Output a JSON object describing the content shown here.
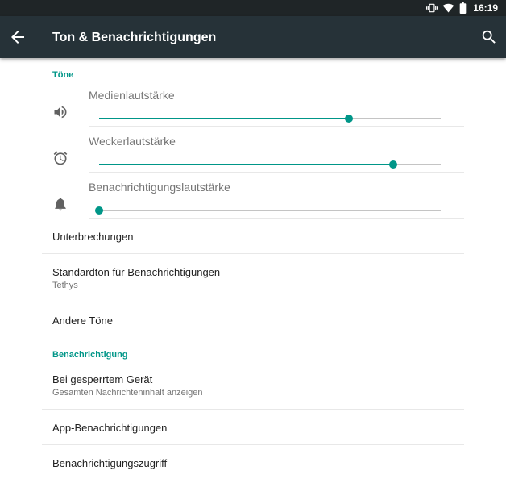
{
  "status_bar": {
    "time": "16:19",
    "icons": [
      "vibrate-icon",
      "wifi-icon",
      "battery-icon"
    ]
  },
  "toolbar": {
    "title": "Ton & Benachrichtigungen",
    "back_icon": "arrow-back-icon",
    "search_icon": "search-icon"
  },
  "colors": {
    "toolbar": "#263238",
    "status_bar": "#1f2527",
    "accent": "#009688"
  },
  "sections": {
    "tones": {
      "header": "Töne",
      "volumes": [
        {
          "label": "Medienlautstärke",
          "icon": "speaker-icon",
          "level_percent": 73
        },
        {
          "label": "Weckerlautstärke",
          "icon": "alarm-clock-icon",
          "level_percent": 86
        },
        {
          "label": "Benachrichtigungslautstärke",
          "icon": "bell-icon",
          "level_percent": 0
        }
      ],
      "items": [
        {
          "title": "Unterbrechungen"
        },
        {
          "title": "Standardton für Benachrichtigungen",
          "summary": "Tethys"
        },
        {
          "title": "Andere Töne"
        }
      ]
    },
    "notification": {
      "header": "Benachrichtigung",
      "items": [
        {
          "title": "Bei gesperrtem Gerät",
          "summary": "Gesamten Nachrichteninhalt anzeigen"
        },
        {
          "title": "App-Benachrichtigungen"
        },
        {
          "title": "Benachrichtigungszugriff"
        }
      ]
    }
  }
}
